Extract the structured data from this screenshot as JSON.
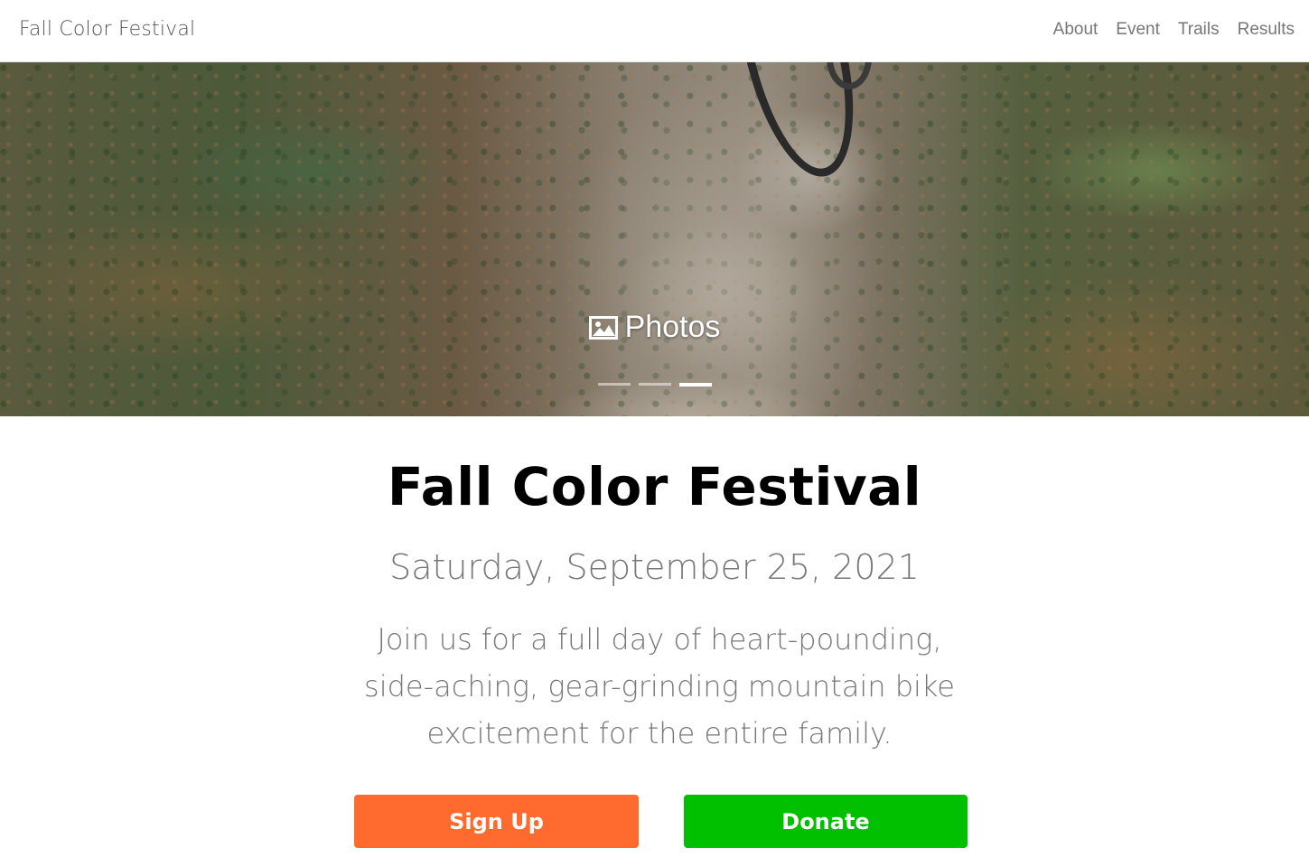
{
  "navbar": {
    "brand": "Fall Color Festival",
    "links": [
      "About",
      "Event",
      "Trails",
      "Results"
    ]
  },
  "hero": {
    "caption": "Photos",
    "caption_icon": "image-icon",
    "slide_count": 3,
    "active_slide": 3
  },
  "main": {
    "title": "Fall Color Festival",
    "date": "Saturday, September 25, 2021",
    "lead": "Join us for a full day of heart-pounding, side-aching, gear-grinding mountain bike excitement for the entire family.",
    "buttons": {
      "signup": "Sign Up",
      "donate": "Donate"
    }
  },
  "colors": {
    "signup": "#ff6a2e",
    "donate": "#00c000",
    "muted_text": "#777777"
  }
}
